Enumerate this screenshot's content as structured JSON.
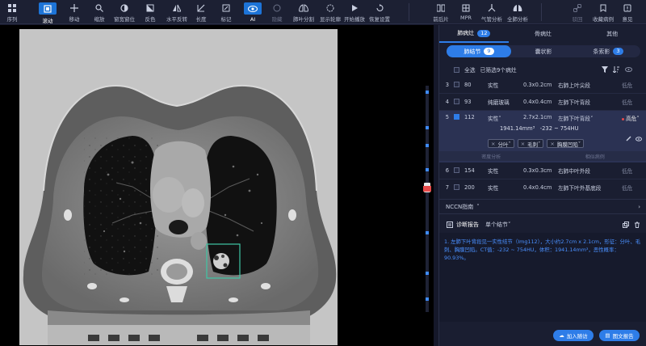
{
  "toolbar": {
    "tools": [
      {
        "label": "序列",
        "icon": "series-icon"
      },
      {
        "label": "滚动",
        "icon": "scroll-icon",
        "active": true
      },
      {
        "label": "移动",
        "icon": "move-icon"
      },
      {
        "label": "缩放",
        "icon": "zoom-icon"
      },
      {
        "label": "窗宽窗位",
        "icon": "window-level-icon"
      },
      {
        "label": "反色",
        "icon": "invert-icon"
      },
      {
        "label": "水平反转",
        "icon": "flip-horizontal-icon"
      },
      {
        "label": "长度",
        "icon": "ruler-icon"
      },
      {
        "label": "标记",
        "icon": "mark-icon"
      },
      {
        "label": "AI",
        "icon": "eye-icon",
        "active": true
      },
      {
        "label": "隐藏",
        "icon": "hide-icon",
        "dim": true
      },
      {
        "label": "肺叶分割",
        "icon": "lung-lobe-icon"
      },
      {
        "label": "显示轮廓",
        "icon": "contour-icon"
      },
      {
        "label": "开始播放",
        "icon": "play-icon"
      },
      {
        "label": "恢复设置",
        "icon": "reset-icon"
      },
      {
        "label": "前后片",
        "icon": "compare-icon"
      },
      {
        "label": "MPR",
        "icon": "mpr-icon"
      },
      {
        "label": "气管分析",
        "icon": "trachea-icon"
      },
      {
        "label": "全肺分析",
        "icon": "lung-analysis-icon"
      },
      {
        "label": "驳回",
        "icon": "link-icon",
        "dim": true
      },
      {
        "label": "收藏病例",
        "icon": "favorite-icon"
      },
      {
        "label": "意见",
        "icon": "feedback-icon"
      }
    ]
  },
  "panel": {
    "top_tabs": [
      {
        "label": "肺病灶",
        "count": "12"
      },
      {
        "label": "骨病灶"
      },
      {
        "label": "其他"
      }
    ],
    "sub_tabs": [
      {
        "label": "肺结节",
        "count": "9"
      },
      {
        "label": "囊状影"
      },
      {
        "label": "条索影",
        "count": "3"
      }
    ],
    "select_all_label": "全选",
    "selected_text": "已筛选9个病灶",
    "rows": [
      {
        "no": "3",
        "slice": "80",
        "type": "实性",
        "size": "0.3x0.2cm",
        "location": "右肺上叶尖段",
        "risk": "低危"
      },
      {
        "no": "4",
        "slice": "93",
        "type": "纯磨玻璃",
        "size": "0.4x0.4cm",
        "location": "左肺下叶背段",
        "risk": "低危"
      },
      {
        "no": "5",
        "slice": "112",
        "type": "实性",
        "size": "2.7x2.1cm",
        "location": "左肺下叶背段",
        "risk": "高危",
        "volume": "1941.14mm³",
        "ct_range": "-232 ~ 754HU",
        "tags": [
          "分叶",
          "毛刺",
          "胸膜凹陷"
        ],
        "ghost": [
          "密度分析",
          "相似病例"
        ]
      },
      {
        "no": "6",
        "slice": "154",
        "type": "实性",
        "size": "0.3x0.3cm",
        "location": "右肺中叶外段",
        "risk": "低危"
      },
      {
        "no": "7",
        "slice": "200",
        "type": "实性",
        "size": "0.4x0.4cm",
        "location": "左肺下叶外基底段",
        "risk": "低危"
      }
    ],
    "nccn_label": "NCCN指南",
    "report": {
      "title": "诊断报告",
      "mode": "单个结节",
      "text": "1. 左肺下叶背段见一实性结节（Img112），大小约2.7cm x 2.1cm，形征：分叶、毛刺、胸膜凹陷。CT值：-232 ~ 754HU，体积：1941.14mm³，恶性概率：90.93%。"
    },
    "buttons": {
      "add_case": "加入随访",
      "copy_report": "图文报告"
    }
  },
  "colors": {
    "accent": "#2e7de8",
    "danger": "#e84a4a",
    "roi": "#3fc6a5"
  }
}
